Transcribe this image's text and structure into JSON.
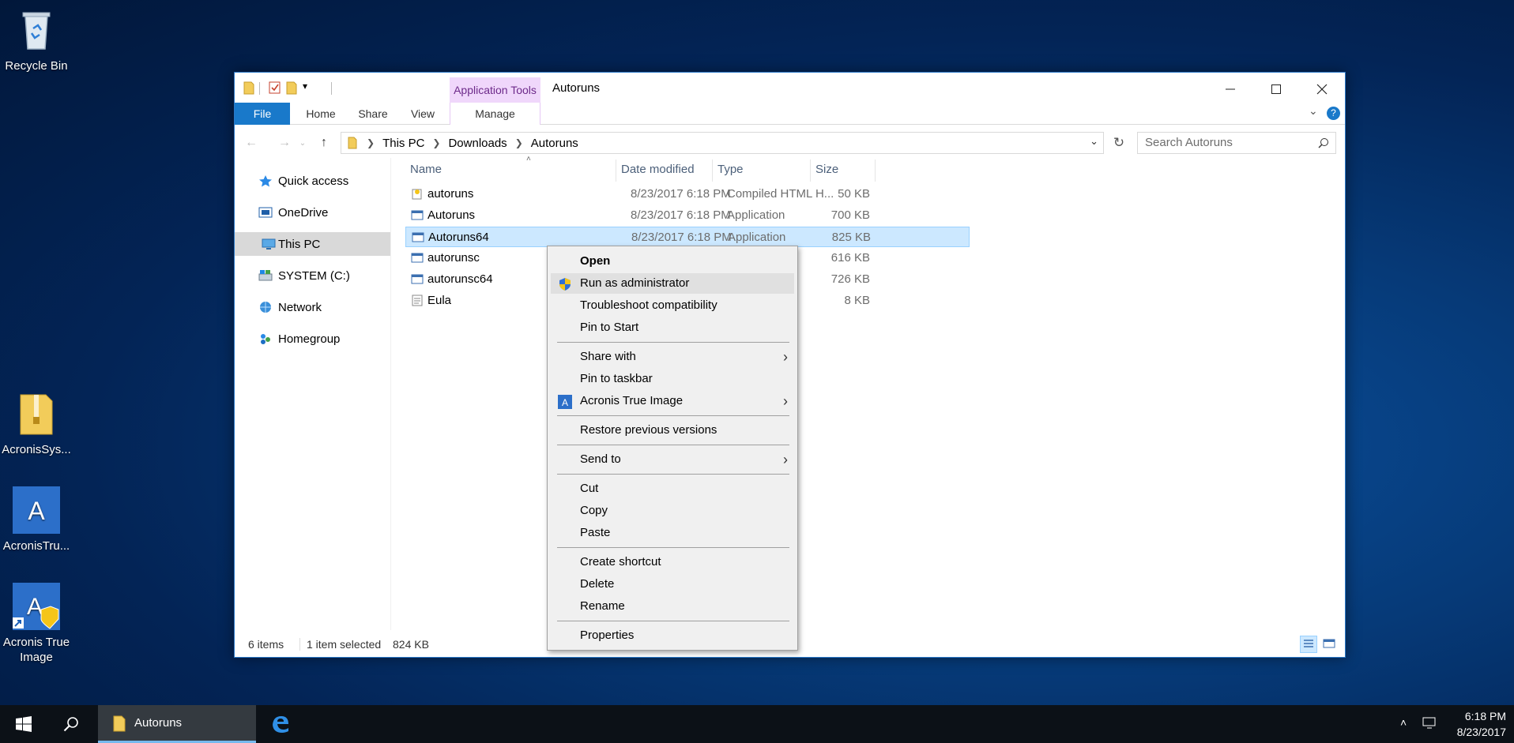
{
  "desktop": {
    "icons": [
      {
        "label": "Recycle Bin"
      },
      {
        "label": "AcronisSys..."
      },
      {
        "label": "AcronisTru..."
      },
      {
        "label": "Acronis True Image"
      }
    ]
  },
  "window": {
    "title": "Autoruns",
    "context_tab_label": "Application Tools",
    "ribbon_tabs": {
      "file": "File",
      "home": "Home",
      "share": "Share",
      "view": "View",
      "manage": "Manage"
    },
    "breadcrumb": [
      "This PC",
      "Downloads",
      "Autoruns"
    ],
    "search_placeholder": "Search Autoruns"
  },
  "nav_pane": [
    {
      "label": "Quick access"
    },
    {
      "label": "OneDrive"
    },
    {
      "label": "This PC"
    },
    {
      "label": "SYSTEM (C:)"
    },
    {
      "label": "Network"
    },
    {
      "label": "Homegroup"
    }
  ],
  "columns": {
    "name": "Name",
    "date": "Date modified",
    "type": "Type",
    "size": "Size"
  },
  "files": [
    {
      "name": "autoruns",
      "date": "8/23/2017 6:18 PM",
      "type": "Compiled HTML H...",
      "size": "50 KB"
    },
    {
      "name": "Autoruns",
      "date": "8/23/2017 6:18 PM",
      "type": "Application",
      "size": "700 KB"
    },
    {
      "name": "Autoruns64",
      "date": "8/23/2017 6:18 PM",
      "type": "Application",
      "size": "825 KB"
    },
    {
      "name": "autorunsc",
      "date": "",
      "type": "pplication",
      "size": "616 KB"
    },
    {
      "name": "autorunsc64",
      "date": "",
      "type": "pplication",
      "size": "726 KB"
    },
    {
      "name": "Eula",
      "date": "",
      "type": "xt Document",
      "size": "8 KB"
    }
  ],
  "status": {
    "items": "6 items",
    "selected": "1 item selected",
    "size": "824 KB"
  },
  "context_menu": {
    "open": "Open",
    "run_as_admin": "Run as administrator",
    "troubleshoot": "Troubleshoot compatibility",
    "pin_start": "Pin to Start",
    "share_with": "Share with",
    "pin_taskbar": "Pin to taskbar",
    "acronis": "Acronis True Image",
    "restore": "Restore previous versions",
    "send_to": "Send to",
    "cut": "Cut",
    "copy": "Copy",
    "paste": "Paste",
    "create_shortcut": "Create shortcut",
    "delete": "Delete",
    "rename": "Rename",
    "properties": "Properties"
  },
  "taskbar": {
    "explorer_label": "Autoruns",
    "time": "6:18 PM",
    "date": "8/23/2017"
  },
  "colors": {
    "accent": "#1979ca",
    "selection": "#cce8ff",
    "context_tab": "#f0d7fb"
  }
}
